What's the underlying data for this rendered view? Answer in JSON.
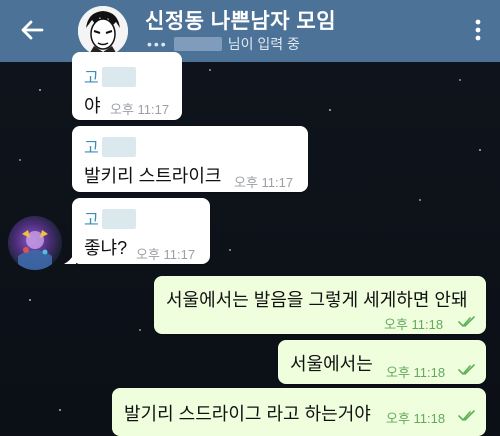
{
  "header": {
    "title": "신정동 나쁜남자 모임",
    "status_dots": "•••",
    "status_text": "님이 입력 중"
  },
  "messages": [
    {
      "sender": "고",
      "text": "야",
      "time": "오후 11:17"
    },
    {
      "sender": "고",
      "text": "발키리 스트라이크",
      "time": "오후 11:17"
    },
    {
      "sender": "고",
      "text": "좋냐?",
      "time": "오후 11:17"
    },
    {
      "text": "서울에서는 발음을 그렇게 세게하면 안돼",
      "time": "오후 11:18"
    },
    {
      "text": "서울에서는",
      "time": "오후 11:18"
    },
    {
      "text": "발기리 스드라이그 라고 하는거야",
      "time": "오후 11:18"
    }
  ],
  "icons": {
    "back": "arrow-left-icon",
    "menu": "more-vertical-icon",
    "read": "double-check-icon"
  },
  "colors": {
    "header": "#4d7298",
    "incoming_bubble": "#ffffff",
    "outgoing_bubble": "#efffde",
    "sender_name": "#3a8fb7",
    "outgoing_time": "#63a85b"
  }
}
